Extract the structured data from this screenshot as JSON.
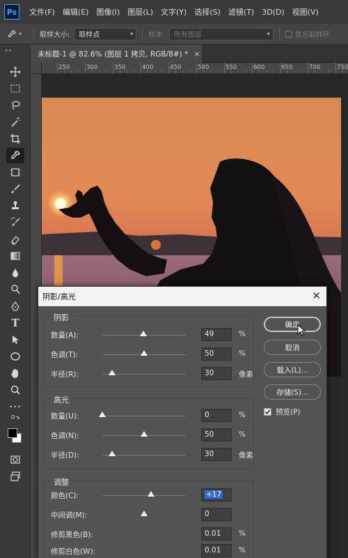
{
  "app": {
    "logo_text": "Ps",
    "menu": [
      "文件(F)",
      "编辑(E)",
      "图像(I)",
      "图层(L)",
      "文字(Y)",
      "选择(S)",
      "滤镜(T)",
      "3D(D)",
      "视图(V)"
    ]
  },
  "options_bar": {
    "sample_size_label": "取样大小:",
    "sample_size_value": "取样点",
    "sample_label": "样本:",
    "sample_value": "所有图层",
    "show_ring_label": "显示取样环"
  },
  "document": {
    "tab_title": "未标题-1 @ 82.6% (图层 1 拷贝, RGB/8#) *",
    "close_glyph": "×"
  },
  "ruler": {
    "marks": [
      "250",
      "300",
      "350",
      "400",
      "450",
      "500",
      "550",
      "600",
      "650",
      "700",
      "750"
    ]
  },
  "toolbar": {
    "tools": [
      "move-icon",
      "marquee-icon",
      "lasso-icon",
      "magic-wand-icon",
      "crop-icon",
      "eyedropper-icon",
      "frame-icon",
      "brush-icon",
      "stamp-icon",
      "history-brush-icon",
      "eraser-icon",
      "gradient-icon",
      "blur-icon",
      "dodge-icon",
      "pen-icon",
      "type-icon",
      "path-select-icon",
      "ellipse-icon",
      "hand-icon",
      "zoom-icon",
      "more-icon",
      "swap-colors-icon",
      "foreground-background-icon",
      "quick-mask-icon",
      "screen-mode-icon"
    ],
    "type_glyph": "T",
    "more_glyph": "•••",
    "active": "eyedropper-icon"
  },
  "dialog": {
    "title": "阴影/高光",
    "close_glyph": "✕",
    "shadows": {
      "title": "阴影",
      "rows": [
        {
          "label": "数量(A):",
          "value": "49",
          "unit": "%",
          "slider": 0.49
        },
        {
          "label": "色调(T):",
          "value": "50",
          "unit": "%",
          "slider": 0.5
        },
        {
          "label": "半径(R):",
          "value": "30",
          "unit": "像素",
          "slider": 0.12
        }
      ]
    },
    "highlights": {
      "title": "高光",
      "rows": [
        {
          "label": "数量(U):",
          "value": "0",
          "unit": "%",
          "slider": 0.0
        },
        {
          "label": "色调(N):",
          "value": "50",
          "unit": "%",
          "slider": 0.5
        },
        {
          "label": "半径(D):",
          "value": "30",
          "unit": "像素",
          "slider": 0.12
        }
      ]
    },
    "adjustments": {
      "title": "调整",
      "rows": [
        {
          "label": "颜色(C):",
          "value": "+17",
          "unit": "",
          "slider": 0.58
        },
        {
          "label": "中间调(M):",
          "value": "0",
          "unit": "",
          "slider": 0.5
        },
        {
          "label": "修剪黑色(B):",
          "value": "0.01",
          "unit": "%",
          "slider": null
        },
        {
          "label": "修剪白色(W):",
          "value": "0.01",
          "unit": "%",
          "slider": null
        }
      ]
    },
    "buttons": {
      "ok": "确定",
      "cancel": "取消",
      "load": "载入(L)...",
      "save": "存储(S)..."
    },
    "preview_label": "预览(P)",
    "preview_checked": true
  },
  "colors": {
    "accent_selection": "#2f6bd9",
    "click_highlight": "#2c9b3c",
    "ps_blue": "#31a8ff"
  }
}
